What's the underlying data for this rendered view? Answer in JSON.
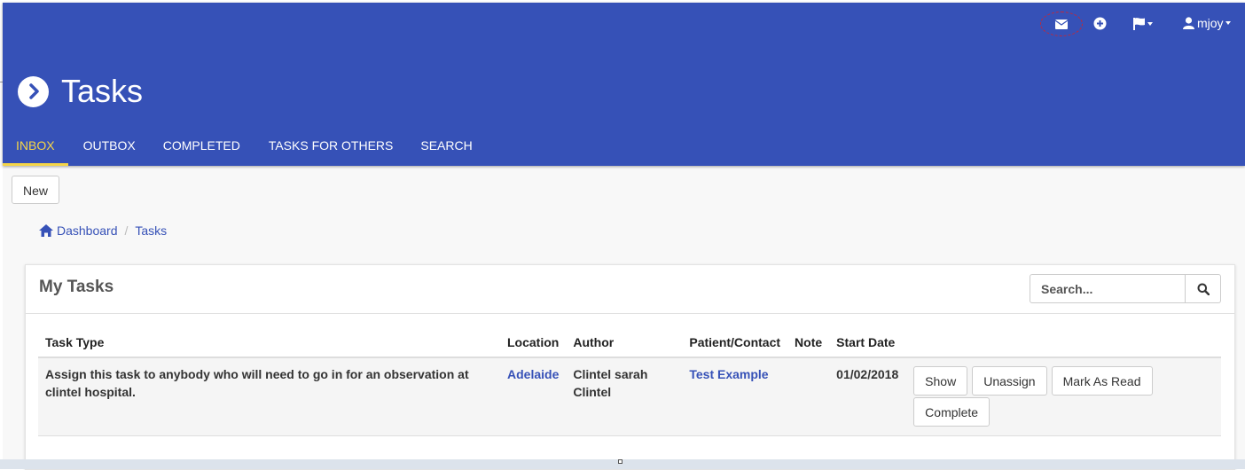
{
  "colors": {
    "header_bg": "#3651b7",
    "active_tab": "#f5d547",
    "link": "#3651b7",
    "mail_highlight": "#c0283a"
  },
  "header": {
    "title": "Tasks",
    "title_icon": "chevron-right-circle-icon",
    "icons": [
      "envelope-icon",
      "plus-circle-icon",
      "flag-icon",
      "user-icon"
    ],
    "user_name": "mjoy"
  },
  "tabs": [
    {
      "label": "INBOX",
      "active": true
    },
    {
      "label": "OUTBOX",
      "active": false
    },
    {
      "label": "COMPLETED",
      "active": false
    },
    {
      "label": "TASKS FOR OTHERS",
      "active": false
    },
    {
      "label": "SEARCH",
      "active": false
    }
  ],
  "new_button": "New",
  "breadcrumb": {
    "home": "Dashboard",
    "current": "Tasks",
    "home_icon": "home-icon"
  },
  "panel": {
    "title": "My Tasks",
    "search_placeholder": "Search...",
    "search_icon": "search-icon"
  },
  "table": {
    "columns": [
      "Task Type",
      "Location",
      "Author",
      "Patient/Contact",
      "Note",
      "Start Date",
      ""
    ],
    "rows": [
      {
        "task_type": "Assign this task to anybody who will need to go in for an observation at clintel hospital.",
        "location": "Adelaide",
        "author": "Clintel sarah Clintel",
        "patient": "Test Example",
        "note": "",
        "start_date": "01/02/2018",
        "actions": [
          "Show",
          "Unassign",
          "Mark As Read",
          "Complete"
        ]
      }
    ]
  }
}
